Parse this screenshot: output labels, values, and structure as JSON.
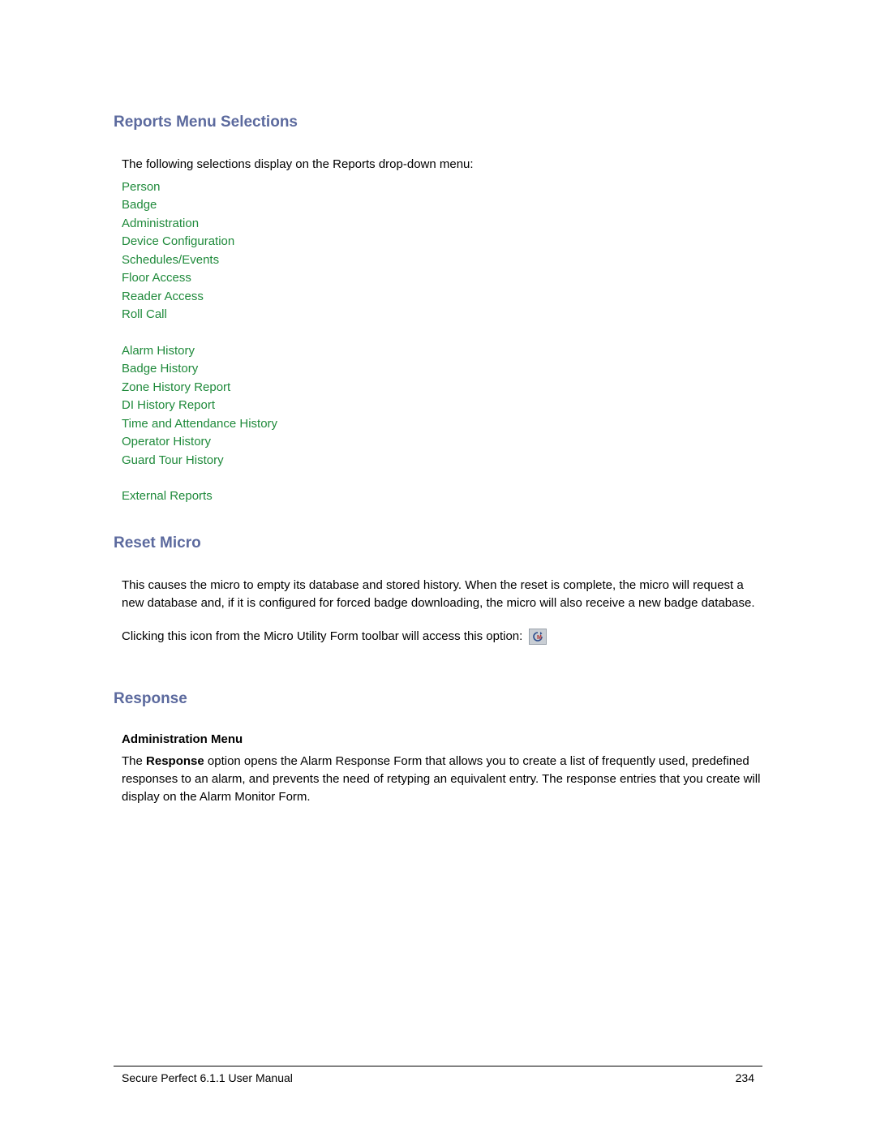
{
  "sections": {
    "reports": {
      "heading": "Reports Menu Selections",
      "intro": "The following selections display on the Reports drop-down menu:",
      "group1": [
        "Person",
        "Badge",
        "Administration",
        "Device Configuration",
        "Schedules/Events",
        "Floor Access",
        "Reader Access",
        "Roll Call"
      ],
      "group2": [
        "Alarm History",
        "Badge History",
        "Zone History Report",
        "DI History Report",
        "Time and Attendance History",
        "Operator History",
        "Guard Tour History"
      ],
      "group3": [
        "External Reports"
      ]
    },
    "reset": {
      "heading": "Reset Micro",
      "para1": "This causes the micro to empty its database and stored history. When the reset is complete, the micro will request a new database and, if it is configured for forced badge downloading, the micro will also receive a new badge database.",
      "para2_pre": "Clicking this icon from the Micro Utility Form toolbar will access this option: "
    },
    "response": {
      "heading": "Response",
      "subheading": "Administration Menu",
      "body_pre": "The ",
      "body_bold": "Response",
      "body_post": " option opens the Alarm Response Form that allows you to create a list of frequently used, predefined responses to an alarm, and prevents the need of retyping an equivalent entry. The response entries that you create will display on the Alarm Monitor Form."
    }
  },
  "footer": {
    "title": "Secure Perfect 6.1.1 User Manual",
    "page": "234"
  }
}
